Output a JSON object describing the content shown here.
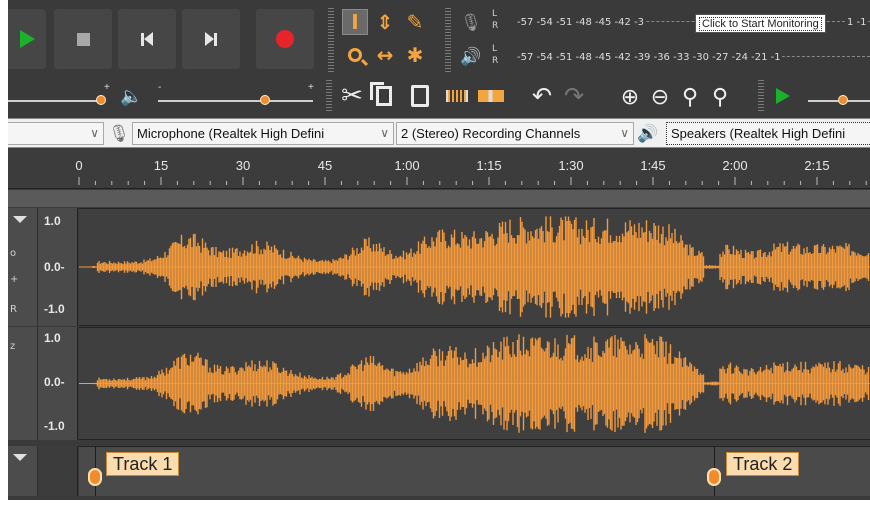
{
  "window": {
    "title": "",
    "colors": {
      "background": "#3a3a3a",
      "accent": "#f28b2c",
      "waveform": "#f39a3c",
      "record": "#e8242b",
      "play": "#1cb12a"
    }
  },
  "transport": {
    "buttons": [
      {
        "name": "play",
        "icon": "play-icon"
      },
      {
        "name": "stop",
        "icon": "stop-icon"
      },
      {
        "name": "skip-to-start",
        "icon": "skip-start-icon"
      },
      {
        "name": "skip-to-end",
        "icon": "skip-end-icon"
      },
      {
        "name": "record",
        "icon": "record-icon"
      }
    ]
  },
  "tools": {
    "selection": "I",
    "envelope": "⇕",
    "draw": "✎",
    "zoom": "🔍",
    "time_shift": "↔",
    "multi": "✱"
  },
  "meters": {
    "record_label_l": "L",
    "record_label_r": "R",
    "play_label_l": "L",
    "play_label_r": "R",
    "record_scale": "-57 -54 -51 -48 -45 -42 -3",
    "record_scale_tail": "1 -1",
    "play_scale": "-57 -54 -51 -48 -45 -42 -39 -36 -33 -30 -27 -24 -21 -1",
    "monitor_tooltip": "Click to Start Monitoring"
  },
  "mixer": {
    "recording_volume_level": 0.8,
    "playback_volume_level": 0.75,
    "minus": "-",
    "plus": "+"
  },
  "devices": {
    "host": "",
    "recording_device": "Microphone (Realtek High Defini",
    "channels": "2 (Stereo) Recording Channels",
    "playback_device": "Speakers (Realtek High Defini"
  },
  "ruler": {
    "ticks": [
      "0",
      "15",
      "30",
      "45",
      "1:00",
      "1:15",
      "1:30",
      "1:45",
      "2:00",
      "2:15"
    ]
  },
  "tracks": {
    "channel_top": {
      "max": "1.0",
      "mid": "0.0-",
      "min": "-1.0"
    },
    "channel_bottom": {
      "max": "1.0",
      "mid": "0.0-",
      "min": "-1.0"
    }
  },
  "labels": {
    "track1": "Track 1",
    "track2": "Track 2"
  }
}
